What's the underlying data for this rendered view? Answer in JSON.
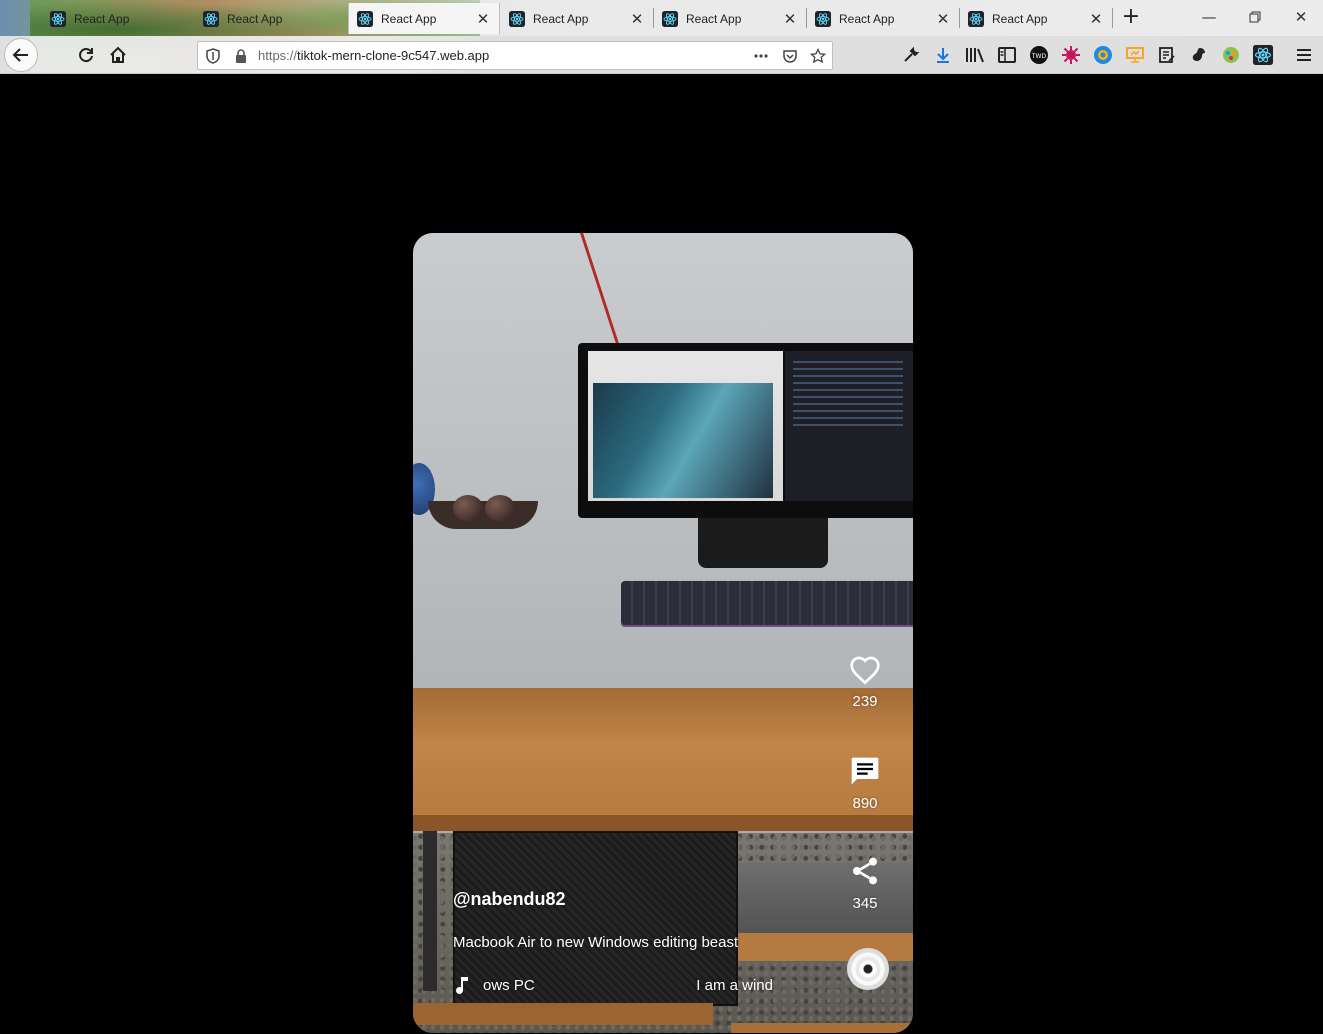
{
  "browser": {
    "tabs": [
      {
        "title": "React App",
        "active": false
      },
      {
        "title": "React App",
        "active": false
      },
      {
        "title": "React App",
        "active": true
      },
      {
        "title": "React App",
        "active": false
      },
      {
        "title": "React App",
        "active": false
      },
      {
        "title": "React App",
        "active": false
      },
      {
        "title": "React App",
        "active": false
      }
    ],
    "url_scheme": "https://",
    "url_host": "tiktok-mern-clone-9c547.web.app"
  },
  "video": {
    "channel": "@nabendu82",
    "description": "Macbook Air to new Windows editing beast",
    "song_left": "ows PC",
    "song_right": "I am a wind",
    "likes": "239",
    "messages": "890",
    "shares": "345"
  },
  "colors": {
    "react_blue": "#61dafb",
    "overlay_text": "#ffffff",
    "page_bg": "#000000"
  }
}
